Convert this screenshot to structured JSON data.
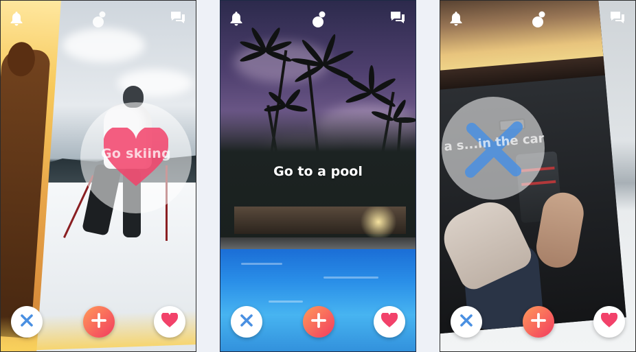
{
  "screens": [
    {
      "id": "skiing",
      "card_label": "Go skiing",
      "swipe_state": "like"
    },
    {
      "id": "pool",
      "card_label": "Go to a pool",
      "swipe_state": "none"
    },
    {
      "id": "car",
      "card_label": "r a s...in the car",
      "swipe_state": "nope"
    }
  ],
  "icons": {
    "bell": "bell-icon",
    "logo": "app-logo-icon",
    "chat": "chat-icon",
    "nope": "x-icon",
    "add": "plus-icon",
    "like": "heart-icon"
  },
  "colors": {
    "nope_blue": "#4a90e2",
    "like_pink": "#f2426a",
    "add_gradient_start": "#ff9a5a",
    "add_gradient_end": "#f23b5f",
    "icon_white": "#ffffff",
    "background": "#eef1f7"
  }
}
